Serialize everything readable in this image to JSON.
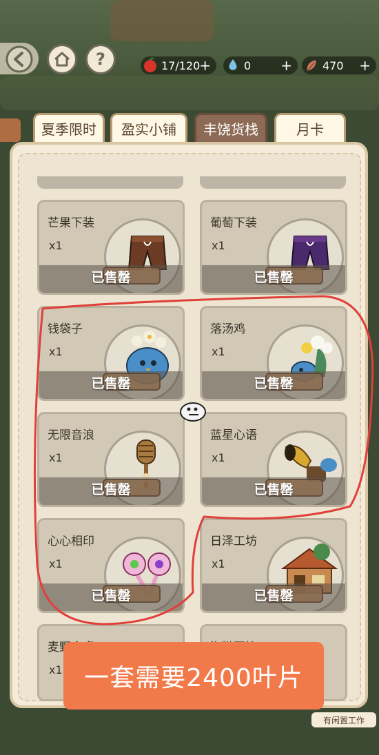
{
  "hud": {
    "back_icon": "back-arrow-icon",
    "home_icon": "home-icon",
    "help_label": "?",
    "resources": [
      {
        "icon": "apple-icon",
        "value": "17/120",
        "plus": "+"
      },
      {
        "icon": "water-drop-icon",
        "value": "0",
        "plus": "+"
      },
      {
        "icon": "leaf-icon",
        "value": "470",
        "plus": "+"
      }
    ]
  },
  "tabs": [
    {
      "label": "夏季限时",
      "active": false
    },
    {
      "label": "盈实小铺",
      "active": false
    },
    {
      "label": "丰饶货栈",
      "active": true
    },
    {
      "label": "月卡",
      "active": false
    }
  ],
  "items": [
    {
      "name": "芒果下装",
      "qty": "x1",
      "status": "已售罄",
      "icon": "brown-shorts-icon"
    },
    {
      "name": "葡萄下装",
      "qty": "x1",
      "status": "已售罄",
      "icon": "purple-shorts-icon"
    },
    {
      "name": "钱袋子",
      "qty": "x1",
      "status": "已售罄",
      "icon": "blue-money-bag-icon"
    },
    {
      "name": "落汤鸡",
      "qty": "x1",
      "status": "已售罄",
      "icon": "flower-bird-icon"
    },
    {
      "name": "无限音浪",
      "qty": "x1",
      "status": "已售罄",
      "icon": "microphone-icon"
    },
    {
      "name": "蓝星心语",
      "qty": "x1",
      "status": "已售罄",
      "icon": "gramophone-icon"
    },
    {
      "name": "心心相印",
      "qty": "x1",
      "status": "已售罄",
      "icon": "heart-wands-icon"
    },
    {
      "name": "日泽工坊",
      "qty": "x1",
      "status": "已售罄",
      "icon": "workshop-house-icon"
    },
    {
      "name": "麦野食桌",
      "qty": "x1",
      "status": "",
      "icon": ""
    },
    {
      "name": "海獭园篱",
      "qty": "",
      "status": "",
      "icon": ""
    }
  ],
  "overlay": {
    "message": "一套需要2400叶片"
  },
  "footer": {
    "hint": "有闲置工作"
  },
  "colors": {
    "accent": "#f27a4a",
    "active_tab": "#8c6a55",
    "annotation": "#e0403a"
  }
}
